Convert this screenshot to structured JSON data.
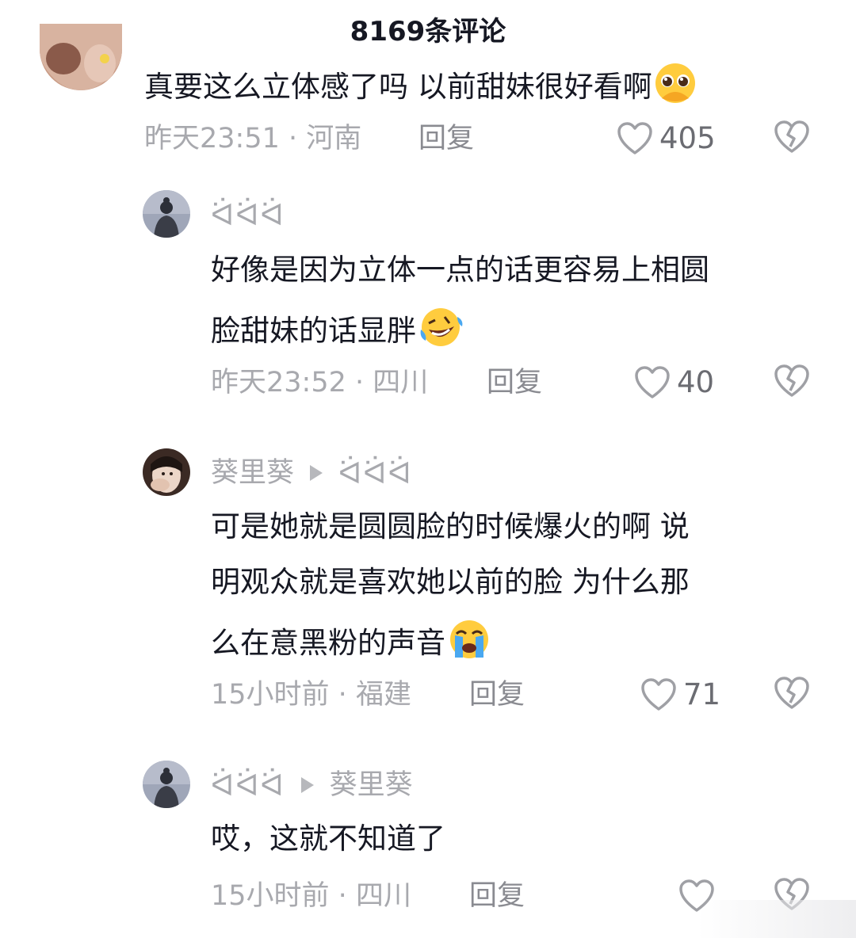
{
  "header": {
    "title": "8169条评论"
  },
  "comments": [
    {
      "text_lines": [
        "真要这么立体感了吗 以前甜妹很好看啊"
      ],
      "emoji": "pleading-face-emoji",
      "time": "昨天23:51",
      "location": "河南",
      "reply_label": "回复",
      "likes": "405"
    },
    {
      "username": "ᐛᐛᐛ",
      "text_lines": [
        "好像是因为立体一点的话更容易上相圆",
        "脸甜妹的话显胖"
      ],
      "emoji": "rofl-emoji",
      "time": "昨天23:52",
      "location": "四川",
      "reply_label": "回复",
      "likes": "40"
    },
    {
      "username": "葵里葵",
      "reply_to": "ᐛᐛᐛ",
      "text_lines": [
        "可是她就是圆圆脸的时候爆火的啊 说",
        "明观众就是喜欢她以前的脸 为什么那",
        "么在意黑粉的声音"
      ],
      "emoji": "crying-face-emoji",
      "time": "15小时前",
      "location": "福建",
      "reply_label": "回复",
      "likes": "71"
    },
    {
      "username": "ᐛᐛᐛ",
      "reply_to": "葵里葵",
      "text_lines": [
        "哎，这就不知道了"
      ],
      "time": "15小时前",
      "location": "四川",
      "reply_label": "回复",
      "likes": ""
    }
  ],
  "meta_separator": " · ",
  "colors": {
    "text": "#161823",
    "meta": "#a8a9ae",
    "icon": "#9fa0a5"
  }
}
